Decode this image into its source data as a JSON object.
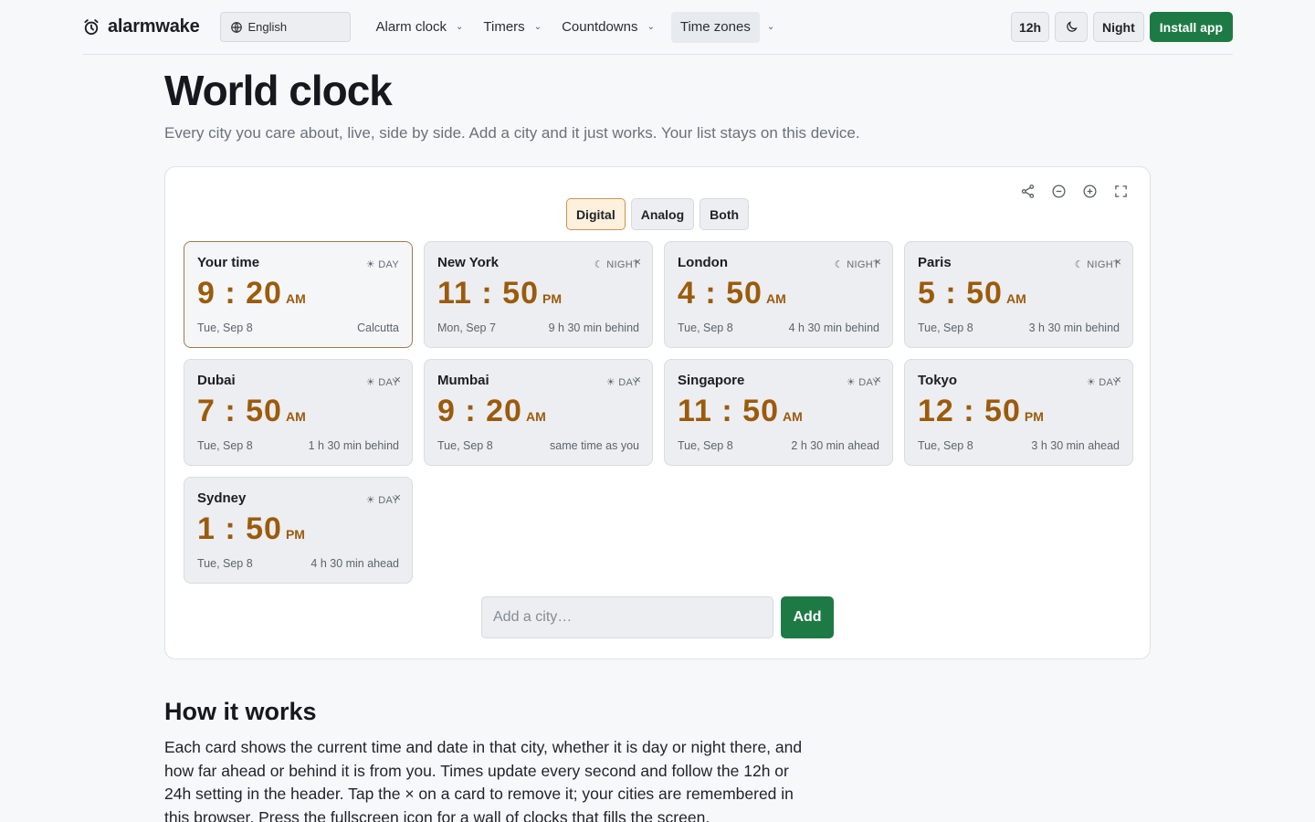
{
  "app": {
    "name": "alarmwake"
  },
  "header": {
    "language": "English",
    "nav": [
      {
        "label": "Alarm clock"
      },
      {
        "label": "Timers"
      },
      {
        "label": "Countdowns"
      },
      {
        "label": "Time zones",
        "active": true
      }
    ],
    "format_label": "12h",
    "night_label": "Night",
    "install_label": "Install app"
  },
  "page": {
    "title": "World clock",
    "subtitle": "Every city you care about, live, side by side. Add a city and it just works. Your list stays on this device."
  },
  "view_modes": [
    "Digital",
    "Analog",
    "Both"
  ],
  "selected_view": "Digital",
  "cards": [
    {
      "city": "Your time",
      "period": "☀ DAY",
      "time": "9 : 20",
      "ampm": "AM",
      "date": "Tue, Sep 8",
      "diff": "Calcutta",
      "is_you": true
    },
    {
      "city": "New York",
      "period": "☾ NIGHT",
      "time": "11 : 50",
      "ampm": "PM",
      "date": "Mon, Sep 7",
      "diff": "9 h 30 min behind"
    },
    {
      "city": "London",
      "period": "☾ NIGHT",
      "time": "4 : 50",
      "ampm": "AM",
      "date": "Tue, Sep 8",
      "diff": "4 h 30 min behind"
    },
    {
      "city": "Paris",
      "period": "☾ NIGHT",
      "time": "5 : 50",
      "ampm": "AM",
      "date": "Tue, Sep 8",
      "diff": "3 h 30 min behind"
    },
    {
      "city": "Dubai",
      "period": "☀ DAY",
      "time": "7 : 50",
      "ampm": "AM",
      "date": "Tue, Sep 8",
      "diff": "1 h 30 min behind"
    },
    {
      "city": "Mumbai",
      "period": "☀ DAY",
      "time": "9 : 20",
      "ampm": "AM",
      "date": "Tue, Sep 8",
      "diff": "same time as you"
    },
    {
      "city": "Singapore",
      "period": "☀ DAY",
      "time": "11 : 50",
      "ampm": "AM",
      "date": "Tue, Sep 8",
      "diff": "2 h 30 min ahead"
    },
    {
      "city": "Tokyo",
      "period": "☀ DAY",
      "time": "12 : 50",
      "ampm": "PM",
      "date": "Tue, Sep 8",
      "diff": "3 h 30 min ahead"
    },
    {
      "city": "Sydney",
      "period": "☀ DAY",
      "time": "1 : 50",
      "ampm": "PM",
      "date": "Tue, Sep 8",
      "diff": "4 h 30 min ahead"
    }
  ],
  "remove_glyph": "×",
  "add_city": {
    "placeholder": "Add a city…",
    "button": "Add"
  },
  "how_it_works": {
    "title": "How it works",
    "body": "Each card shows the current time and date in that city, whether it is day or night there, and how far ahead or behind it is from you. Times update every second and follow the 12h or 24h setting in the header. Tap the × on a card to remove it; your cities are remembered in this browser. Press the fullscreen icon for a wall of clocks that fills the screen."
  },
  "colors": {
    "accent": "#1e7a45",
    "time": "#9b5b0c",
    "selected_border": "#a5794a"
  }
}
